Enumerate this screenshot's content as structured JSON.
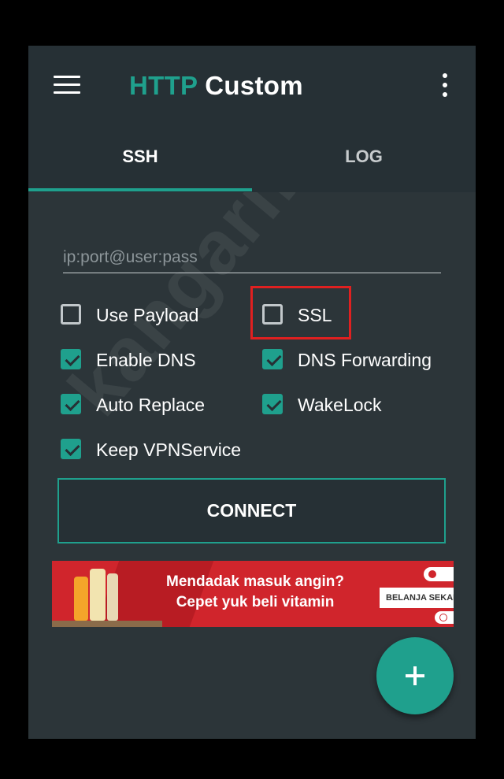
{
  "app": {
    "title_part1": "HTTP",
    "title_part2": "Custom",
    "accent_color": "#1fa08d",
    "highlight_color": "#e02020"
  },
  "tabs": [
    {
      "label": "SSH",
      "active": true
    },
    {
      "label": "LOG",
      "active": false
    }
  ],
  "server_input": {
    "value": "",
    "placeholder": "ip:port@user:pass"
  },
  "options": [
    {
      "label": "Use Payload",
      "checked": false
    },
    {
      "label": "SSL",
      "checked": false
    },
    {
      "label": "Enable DNS",
      "checked": true
    },
    {
      "label": "DNS Forwarding",
      "checked": true
    },
    {
      "label": "Auto Replace",
      "checked": true
    },
    {
      "label": "WakeLock",
      "checked": true
    },
    {
      "label": "Keep VPNService",
      "checked": true
    }
  ],
  "connect_button": {
    "label": "CONNECT"
  },
  "ad": {
    "line1": "Mendadak masuk angin?",
    "line2": "Cepet yuk beli vitamin",
    "cta": "BELANJA SEKAR"
  },
  "fab": {
    "icon": "plus-icon"
  },
  "watermark": "kangarif.net",
  "icons": {
    "menu": "menu-icon",
    "more": "more-vert-icon"
  }
}
